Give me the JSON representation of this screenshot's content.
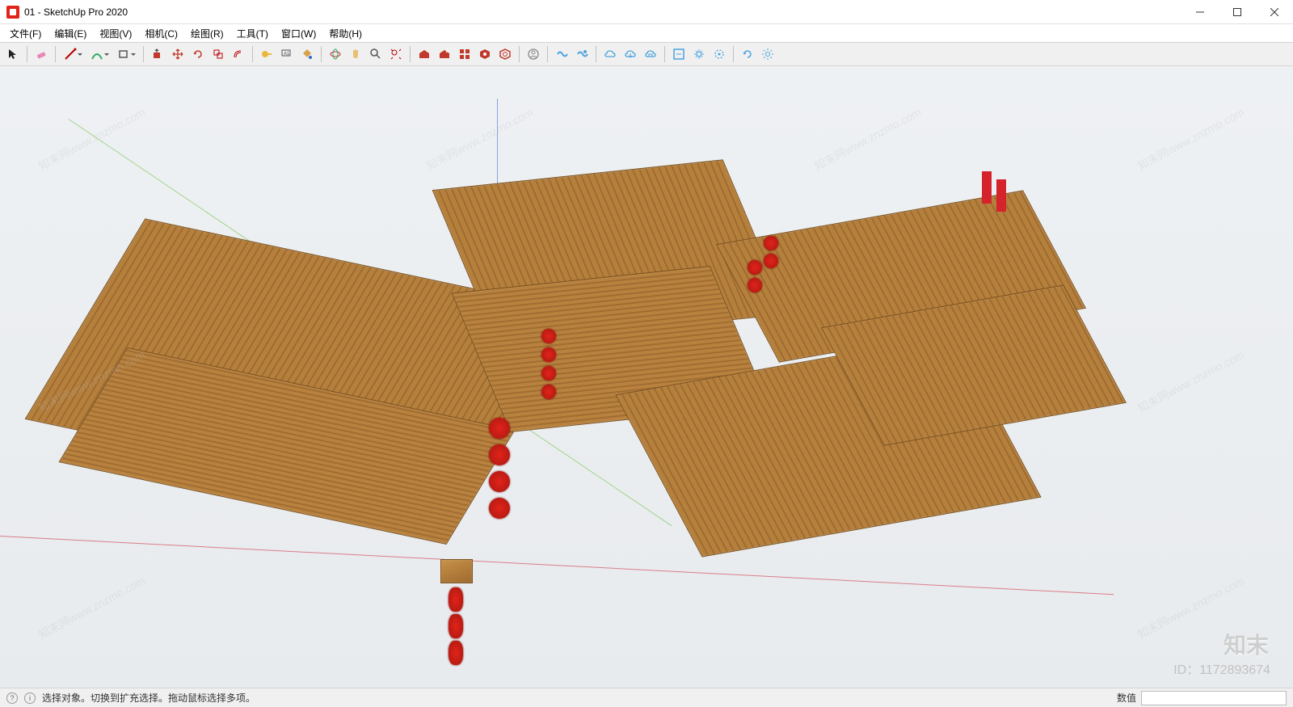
{
  "window": {
    "title": "01 - SketchUp Pro 2020"
  },
  "menu": {
    "file": "文件(F)",
    "edit": "编辑(E)",
    "view": "视图(V)",
    "camera": "相机(C)",
    "draw": "绘图(R)",
    "tools": "工具(T)",
    "window": "窗口(W)",
    "help": "帮助(H)"
  },
  "toolbar": {
    "select": "select",
    "eraser": "eraser",
    "line": "line",
    "arc": "arc",
    "rectangle": "rectangle",
    "circle": "circle",
    "polygon": "polygon",
    "pushpull": "pushpull",
    "move": "move",
    "rotate": "rotate",
    "scale": "scale",
    "offset": "offset",
    "tape": "tape",
    "text": "text",
    "paint": "paint",
    "orbit": "orbit",
    "pan": "pan",
    "zoom": "zoom",
    "zoom_extents": "zoom-extents",
    "warehouse": "3d-warehouse",
    "ext_warehouse": "extension-warehouse",
    "layers": "layers",
    "outliner": "outliner",
    "signin": "signin"
  },
  "status": {
    "hint": "选择对象。切换到扩充选择。拖动鼠标选择多项。",
    "measure_label": "数值"
  },
  "overlay": {
    "brand": "知末",
    "id_label": "ID：1172893674",
    "watermark_text": "知末网www.znzmo.com"
  }
}
